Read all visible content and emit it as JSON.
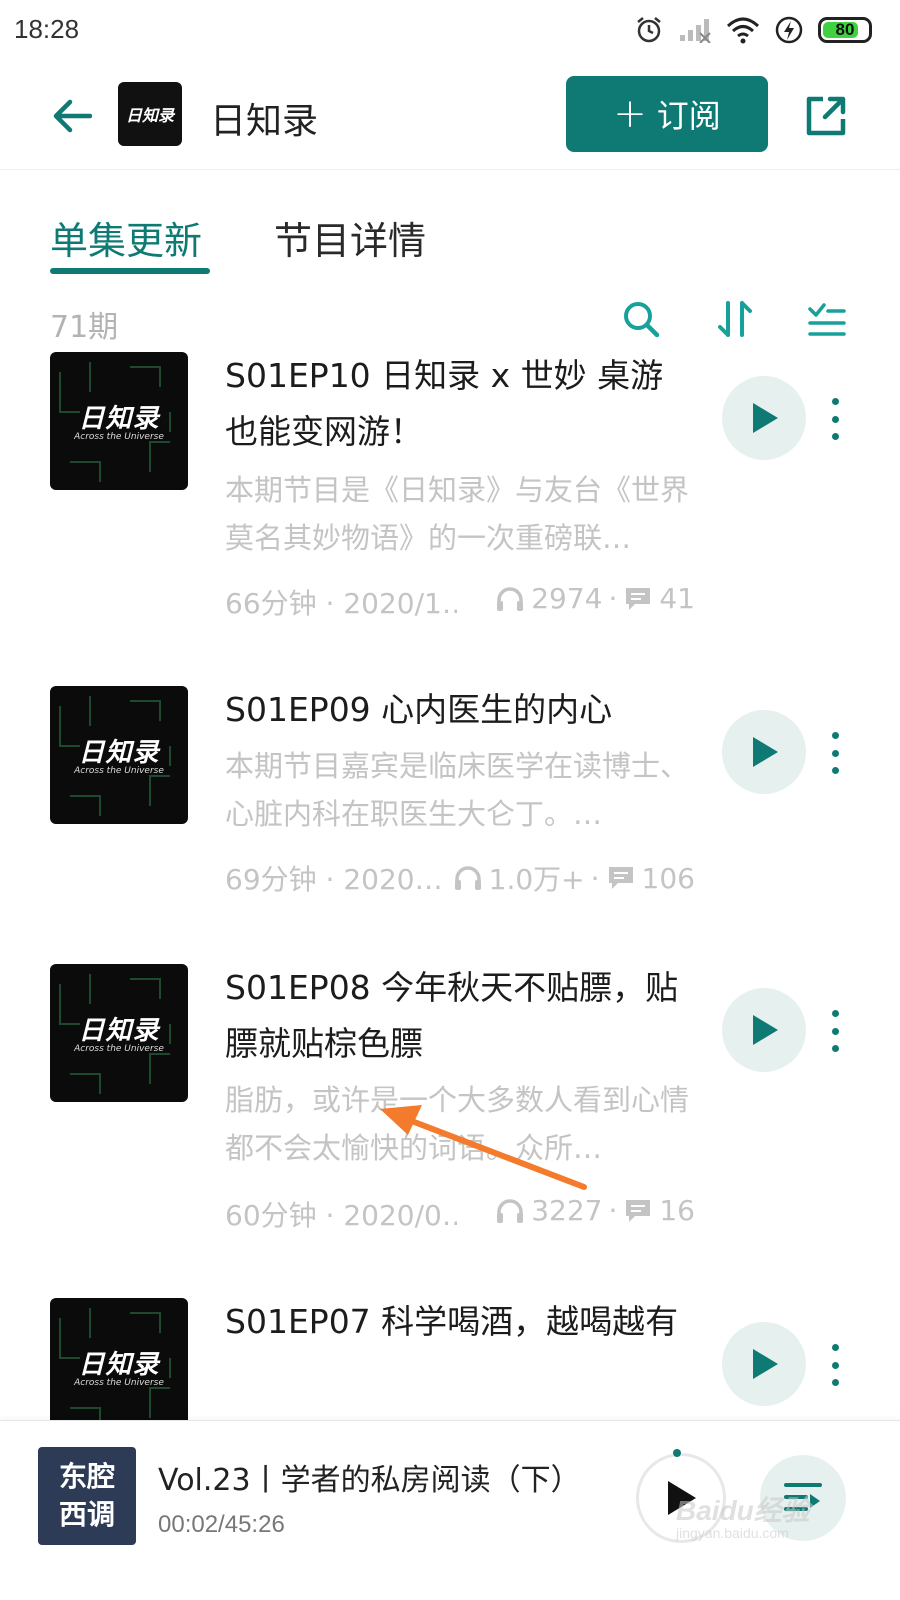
{
  "status_bar": {
    "time": "18:28",
    "battery": "80",
    "battery_level": 0.8,
    "icons": [
      "alarm-icon",
      "signal-icon",
      "wifi-icon",
      "charging-icon",
      "battery-icon"
    ]
  },
  "header": {
    "back_icon": "back-arrow-icon",
    "logo_text": "日知录",
    "title": "日知录",
    "subscribe_plus": "+",
    "subscribe_label": "订阅",
    "share_icon": "share-icon"
  },
  "tabs": [
    {
      "label": "单集更新",
      "active": true
    },
    {
      "label": "节目详情",
      "active": false
    }
  ],
  "toolbar": {
    "count": "71期",
    "icons": [
      "search-icon",
      "sort-icon",
      "filter-icon"
    ]
  },
  "cover": {
    "title": "日知录",
    "subtitle": "Across the Universe"
  },
  "episodes": [
    {
      "title": "S01EP10 日知录 x 世妙 桌游也能变网游！",
      "desc": "本期节目是《日知录》与友台《世界莫名其妙物语》的一次重磅联…",
      "duration": "66分钟 · 2020/1…",
      "plays": "2974",
      "sep": "·",
      "comments": "41"
    },
    {
      "title": "S01EP09 心内医生的内心",
      "desc": "本期节目嘉宾是临床医学在读博士、心脏内科在职医生大仑丁。…",
      "duration": "69分钟 · 2020…",
      "plays": "1.0万+",
      "sep": "·",
      "comments": "106"
    },
    {
      "title": "S01EP08 今年秋天不贴膘，贴膘就贴棕色膘",
      "desc": "脂肪，或许是一个大多数人看到心情都不会太愉快的词语。众所…",
      "duration": "60分钟 · 2020/0…",
      "plays": "3227",
      "sep": "·",
      "comments": "16"
    },
    {
      "title": "S01EP07 科学喝酒，越喝越有",
      "desc": "",
      "duration": "",
      "plays": "",
      "sep": "",
      "comments": ""
    }
  ],
  "mini_player": {
    "cover_line1": "东腔",
    "cover_line2": "西调",
    "title": "Vol.23丨学者的私房阅读（下）",
    "time": "00:02/45:26",
    "play_icon": "play-icon",
    "playlist_icon": "playlist-icon"
  },
  "watermark": {
    "logo": "Baidu经验",
    "url": "jingyan.baidu.com"
  },
  "colors": {
    "accent": "#0f7a74",
    "play_bg": "#e6f1ef",
    "muted_text": "#c4c4c4",
    "annotation_arrow": "#f47a2c"
  }
}
